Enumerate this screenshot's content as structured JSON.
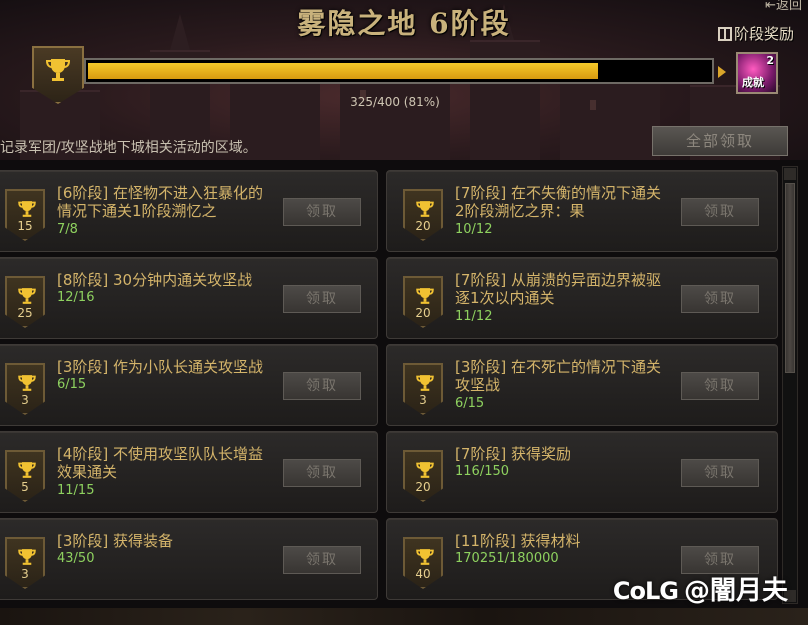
{
  "header": {
    "back_label": "返回",
    "title": "雾隐之地 6阶段",
    "stage_reward_label": "阶段奖励"
  },
  "progress": {
    "fraction": 0.81,
    "text": "325/400 (81%)",
    "reward_count": "2",
    "reward_label": "成就"
  },
  "description": "记录军团/攻坚战地下城相关活动的区域。",
  "claim_all_label": "全部领取",
  "items": [
    {
      "points": "15",
      "name": "[6阶段] 在怪物不进入狂暴化的情况下通关1阶段溯忆之",
      "progress": "7/8",
      "button": "领取"
    },
    {
      "points": "20",
      "name": "[7阶段] 在不失衡的情况下通关2阶段溯忆之界：果",
      "progress": "10/12",
      "button": "领取"
    },
    {
      "points": "25",
      "name": "[8阶段] 30分钟内通关攻坚战",
      "progress": "12/16",
      "button": "领取"
    },
    {
      "points": "20",
      "name": "[7阶段] 从崩溃的异面边界被驱逐1次以内通关",
      "progress": "11/12",
      "button": "领取"
    },
    {
      "points": "3",
      "name": "[3阶段] 作为小队长通关攻坚战",
      "progress": "6/15",
      "button": "领取"
    },
    {
      "points": "3",
      "name": "[3阶段] 在不死亡的情况下通关攻坚战",
      "progress": "6/15",
      "button": "领取"
    },
    {
      "points": "5",
      "name": "[4阶段] 不使用攻坚队队长增益效果通关",
      "progress": "11/15",
      "button": "领取"
    },
    {
      "points": "20",
      "name": "[7阶段] 获得奖励",
      "progress": "116/150",
      "button": "领取"
    },
    {
      "points": "3",
      "name": "[3阶段] 获得装备",
      "progress": "43/50",
      "button": "领取"
    },
    {
      "points": "40",
      "name": "[11阶段] 获得材料",
      "progress": "170251/180000",
      "button": "领取"
    }
  ],
  "watermark": {
    "brand": "CoLG",
    "handle": "@闇月夫"
  },
  "colors": {
    "gold": "#d4b46a",
    "progress_green": "#8ed15f",
    "bar_fill": "#f5c92a"
  }
}
